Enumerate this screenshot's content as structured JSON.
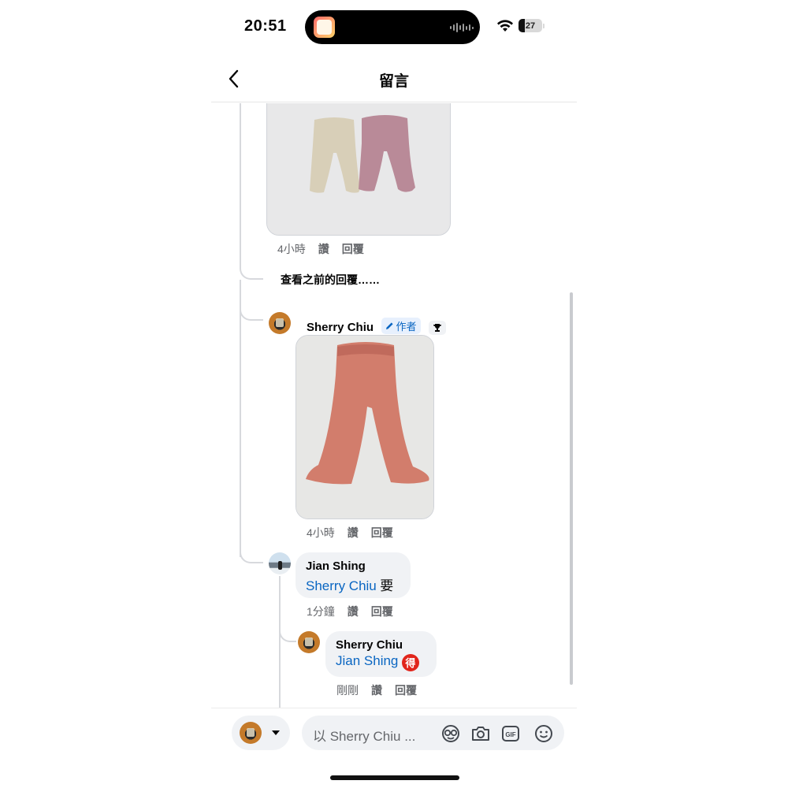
{
  "status_bar": {
    "time": "20:51",
    "battery": "27"
  },
  "header": {
    "title": "留言"
  },
  "thread": {
    "prev_reply": {
      "time": "4小時",
      "like": "讚",
      "reply": "回覆"
    },
    "view_previous": "查看之前的回覆……",
    "comments": [
      {
        "author": "Sherry Chiu",
        "author_badge": "作者",
        "time": "4小時",
        "like": "讚",
        "reply": "回覆"
      },
      {
        "author": "Jian Shing",
        "mention": "Sherry Chiu",
        "text": "要",
        "time": "1分鐘",
        "like": "讚",
        "reply": "回覆"
      },
      {
        "author": "Sherry Chiu",
        "mention": "Jian Shing",
        "emoji": "得",
        "time": "剛剛",
        "like": "讚",
        "reply": "回覆"
      }
    ]
  },
  "composer": {
    "placeholder": "以 Sherry Chiu ..."
  },
  "icons": [
    "back-icon",
    "wifi-icon",
    "battery-icon",
    "trophy-icon",
    "pencil-icon",
    "avatar-sticker-icon",
    "camera-icon",
    "gif-icon",
    "emoji-icon",
    "chevron-down-icon"
  ]
}
